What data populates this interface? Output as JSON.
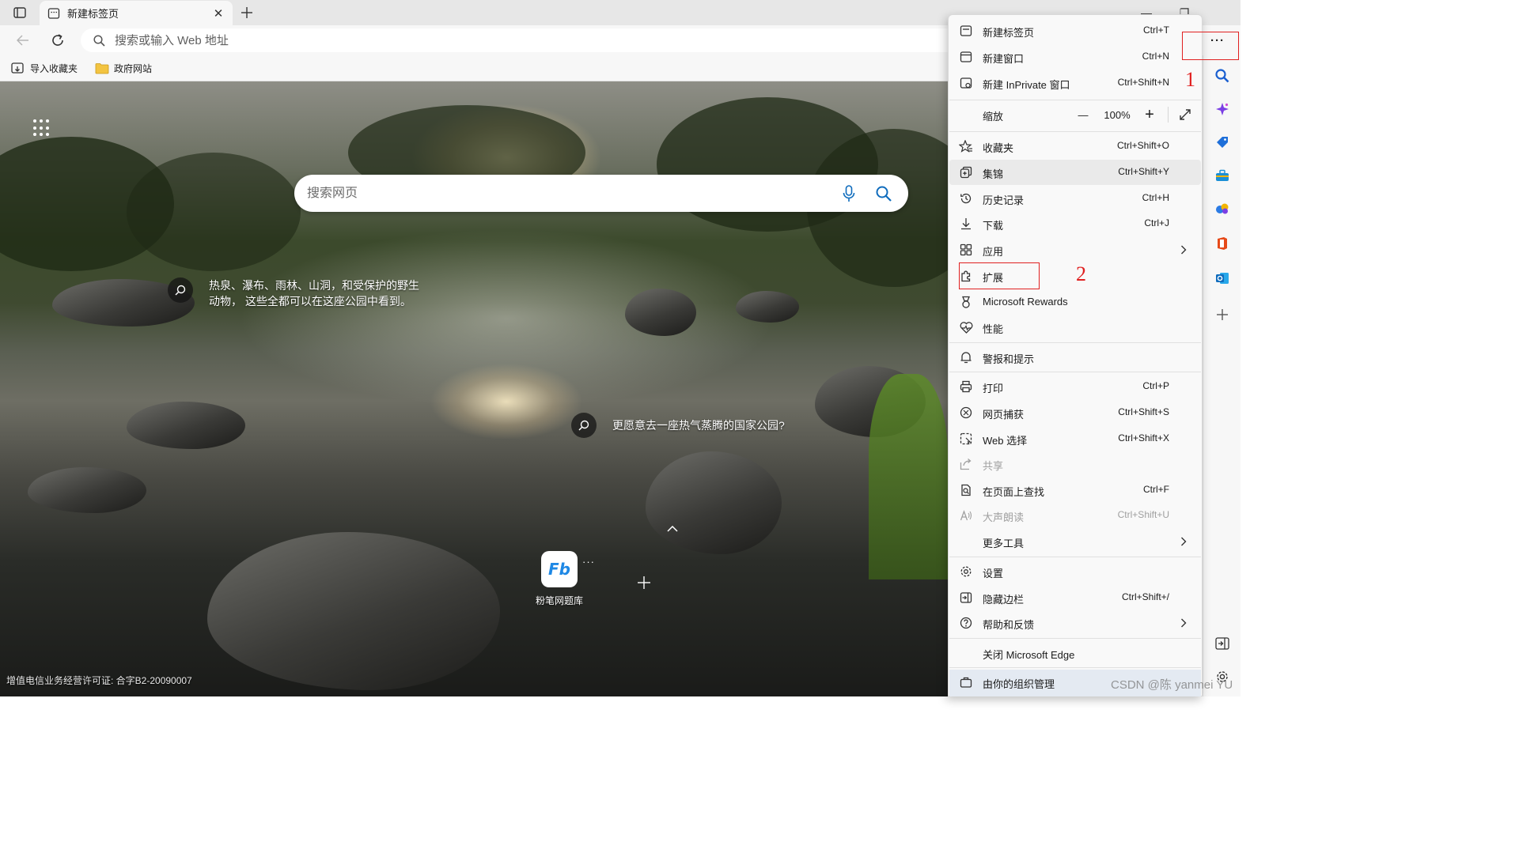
{
  "tab": {
    "title": "新建标签页",
    "close_glyph": "✕"
  },
  "toolbar": {
    "address_placeholder": "搜索或输入 Web 地址",
    "more_glyph": "···"
  },
  "window_controls": {
    "minimize": "—",
    "restore": "❐",
    "close": "✕"
  },
  "favorites_bar": {
    "items": [
      {
        "label": "导入收藏夹",
        "icon": "import-favorites-icon"
      },
      {
        "label": "政府网站",
        "icon": "folder-icon"
      }
    ]
  },
  "ntp": {
    "search_placeholder": "搜索网页",
    "hotspots": [
      {
        "text": "热泉、瀑布、雨林、山洞，和受保护的野生动物， 这些全都可以在这座公园中看到。"
      },
      {
        "text": "更愿意去一座热气蒸腾的国家公园?"
      }
    ],
    "quick_links": [
      {
        "name": "粉笔网题库",
        "logo": "Fb"
      }
    ],
    "quick_link_more": "···",
    "license": "增值电信业务经营许可证: 合字B2-20090007"
  },
  "menu": {
    "items": [
      {
        "id": "new-tab",
        "label": "新建标签页",
        "shortcut": "Ctrl+T",
        "icon": "new-tab-icon"
      },
      {
        "id": "new-window",
        "label": "新建窗口",
        "shortcut": "Ctrl+N",
        "icon": "new-window-icon"
      },
      {
        "id": "new-inprivate",
        "label": "新建 InPrivate 窗口",
        "shortcut": "Ctrl+Shift+N",
        "icon": "inprivate-icon"
      },
      {
        "id": "favorites",
        "label": "收藏夹",
        "shortcut": "Ctrl+Shift+O",
        "icon": "favorites-icon"
      },
      {
        "id": "collections",
        "label": "集锦",
        "shortcut": "Ctrl+Shift+Y",
        "icon": "collections-icon"
      },
      {
        "id": "history",
        "label": "历史记录",
        "shortcut": "Ctrl+H",
        "icon": "history-icon"
      },
      {
        "id": "downloads",
        "label": "下载",
        "shortcut": "Ctrl+J",
        "icon": "download-icon"
      },
      {
        "id": "apps",
        "label": "应用",
        "shortcut": "",
        "icon": "apps-icon"
      },
      {
        "id": "extensions",
        "label": "扩展",
        "shortcut": "",
        "icon": "extensions-icon"
      },
      {
        "id": "rewards",
        "label": "Microsoft Rewards",
        "shortcut": "",
        "icon": "rewards-icon"
      },
      {
        "id": "performance",
        "label": "性能",
        "shortcut": "",
        "icon": "performance-icon"
      },
      {
        "id": "alerts",
        "label": "警报和提示",
        "shortcut": "",
        "icon": "bell-icon"
      },
      {
        "id": "print",
        "label": "打印",
        "shortcut": "Ctrl+P",
        "icon": "print-icon"
      },
      {
        "id": "web-capture",
        "label": "网页捕获",
        "shortcut": "Ctrl+Shift+S",
        "icon": "web-capture-icon"
      },
      {
        "id": "web-select",
        "label": "Web 选择",
        "shortcut": "Ctrl+Shift+X",
        "icon": "web-select-icon"
      },
      {
        "id": "share",
        "label": "共享",
        "shortcut": "",
        "icon": "share-icon"
      },
      {
        "id": "find",
        "label": "在页面上查找",
        "shortcut": "Ctrl+F",
        "icon": "find-icon"
      },
      {
        "id": "read-aloud",
        "label": "大声朗读",
        "shortcut": "Ctrl+Shift+U",
        "icon": "read-aloud-icon"
      },
      {
        "id": "more-tools",
        "label": "更多工具",
        "shortcut": "",
        "icon": ""
      },
      {
        "id": "settings",
        "label": "设置",
        "shortcut": "",
        "icon": "gear-icon"
      },
      {
        "id": "hide-sidebar",
        "label": "隐藏边栏",
        "shortcut": "Ctrl+Shift+/",
        "icon": "sidebar-icon"
      },
      {
        "id": "help",
        "label": "帮助和反馈",
        "shortcut": "",
        "icon": "help-icon"
      },
      {
        "id": "close-edge",
        "label": "关闭 Microsoft Edge",
        "shortcut": "",
        "icon": ""
      },
      {
        "id": "managed",
        "label": "由你的组织管理",
        "shortcut": "",
        "icon": "briefcase-icon"
      }
    ],
    "zoom": {
      "label": "缩放",
      "minus": "—",
      "value": "100%",
      "plus": "+"
    }
  },
  "annotations": {
    "label_1": "1",
    "label_2": "2"
  },
  "watermark": "CSDN @陈 yanmei YU",
  "colors": {
    "annotation": "#e02020",
    "accent": "#0f6cbd"
  }
}
